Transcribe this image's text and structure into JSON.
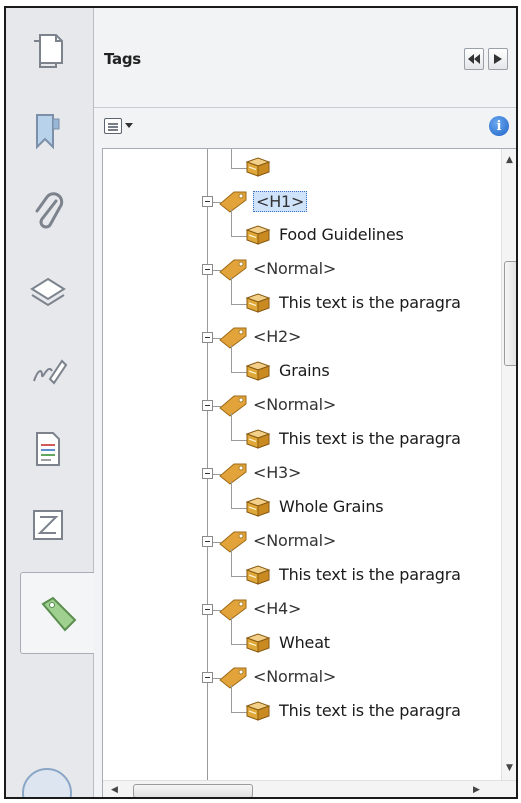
{
  "panel": {
    "title": "Tags",
    "info_label": "i"
  },
  "rail": {
    "items": [
      {
        "name": "pages-icon"
      },
      {
        "name": "bookmark-icon"
      },
      {
        "name": "attachment-icon"
      },
      {
        "name": "layers-icon"
      },
      {
        "name": "signatures-icon"
      },
      {
        "name": "content-icon"
      },
      {
        "name": "order-icon"
      },
      {
        "name": "tag-icon",
        "active": true
      }
    ]
  },
  "tree": {
    "rows": [
      {
        "kind": "content",
        "text": ""
      },
      {
        "kind": "tag",
        "text": "<H1>",
        "selected": true
      },
      {
        "kind": "content",
        "text": "Food Guidelines"
      },
      {
        "kind": "tag",
        "text": "<Normal>"
      },
      {
        "kind": "content",
        "text": "This text is the paragra"
      },
      {
        "kind": "tag",
        "text": "<H2>"
      },
      {
        "kind": "content",
        "text": "Grains"
      },
      {
        "kind": "tag",
        "text": "<Normal>"
      },
      {
        "kind": "content",
        "text": "This text is the paragra"
      },
      {
        "kind": "tag",
        "text": "<H3>"
      },
      {
        "kind": "content",
        "text": "Whole Grains"
      },
      {
        "kind": "tag",
        "text": "<Normal>"
      },
      {
        "kind": "content",
        "text": "This text is the paragra"
      },
      {
        "kind": "tag",
        "text": "<H4>"
      },
      {
        "kind": "content",
        "text": "Wheat"
      },
      {
        "kind": "tag",
        "text": "<Normal>"
      },
      {
        "kind": "content",
        "text": "This text is the paragra"
      }
    ]
  },
  "colors": {
    "tag_fill": "#e2a43a",
    "box_fill": "#e0a838",
    "selection": "#cfe3fb"
  }
}
